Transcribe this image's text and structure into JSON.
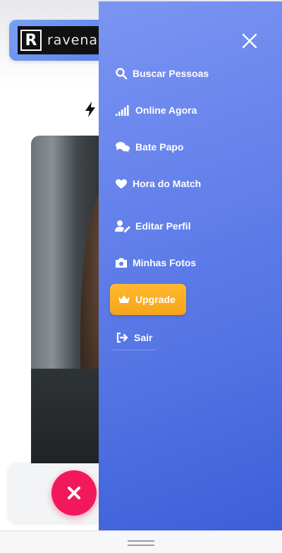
{
  "brand": {
    "logo_mark": "R",
    "logo_text": "ravena"
  },
  "colors": {
    "drawer_top": "#7b95f2",
    "drawer_bottom": "#3c5fd8",
    "upgrade": "#f8a419",
    "dislike": "#f1195c"
  },
  "menu": {
    "close_icon": "close-icon",
    "items": [
      {
        "label": "Buscar Pessoas",
        "icon": "search-icon"
      },
      {
        "label": "Online Agora",
        "icon": "signal-icon"
      },
      {
        "label": "Bate Papo",
        "icon": "chat-icon"
      },
      {
        "label": "Hora do Match",
        "icon": "heart-icon"
      },
      {
        "label": "Editar Perfil",
        "icon": "user-edit-icon"
      },
      {
        "label": "Minhas Fotos",
        "icon": "camera-icon"
      },
      {
        "label": "Upgrade",
        "icon": "crown-icon"
      },
      {
        "label": "Sair",
        "icon": "sign-out-icon"
      }
    ]
  },
  "actions": {
    "dislike_icon": "close-icon"
  }
}
